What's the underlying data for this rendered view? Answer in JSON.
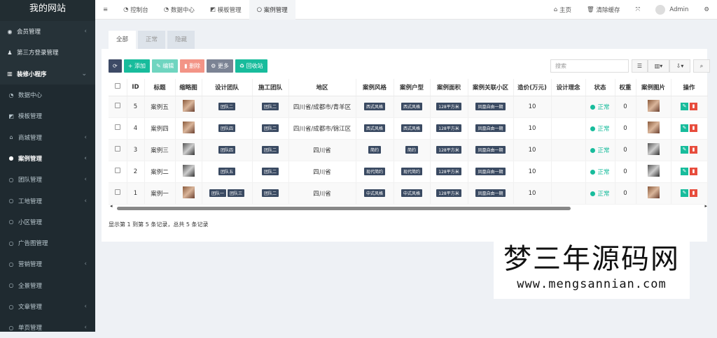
{
  "app": {
    "title": "我的网站"
  },
  "sidebar": {
    "items": [
      {
        "label": "会员管理",
        "icon": "user-circle-icon",
        "arrow": "‹",
        "level": "top"
      },
      {
        "label": "第三方登录管理",
        "icon": "users-icon",
        "arrow": "",
        "level": "top"
      },
      {
        "label": "装修小程序",
        "icon": "bank-icon",
        "arrow": "⌄",
        "level": "top",
        "bold": true
      },
      {
        "label": "数据中心",
        "icon": "dashboard-icon",
        "arrow": "",
        "level": "sub"
      },
      {
        "label": "模板管理",
        "icon": "template-icon",
        "arrow": "",
        "level": "sub"
      },
      {
        "label": "商城管理",
        "icon": "home-icon",
        "arrow": "‹",
        "level": "sub"
      },
      {
        "label": "案例管理",
        "icon": "circle-filled-icon",
        "arrow": "‹",
        "level": "sub",
        "active": true
      },
      {
        "label": "团队管理",
        "icon": "circle-icon",
        "arrow": "‹",
        "level": "sub"
      },
      {
        "label": "工地管理",
        "icon": "circle-icon",
        "arrow": "‹",
        "level": "sub"
      },
      {
        "label": "小区管理",
        "icon": "circle-icon",
        "arrow": "",
        "level": "sub"
      },
      {
        "label": "广告图管理",
        "icon": "circle-icon",
        "arrow": "",
        "level": "sub"
      },
      {
        "label": "营销管理",
        "icon": "circle-icon",
        "arrow": "‹",
        "level": "sub"
      },
      {
        "label": "全景管理",
        "icon": "circle-icon",
        "arrow": "",
        "level": "sub"
      },
      {
        "label": "文章管理",
        "icon": "circle-icon",
        "arrow": "‹",
        "level": "sub"
      },
      {
        "label": "单页管理",
        "icon": "circle-icon",
        "arrow": "‹",
        "level": "sub"
      }
    ]
  },
  "topbar": {
    "menu_icon": "bars-icon",
    "tabs": [
      {
        "label": "控制台",
        "icon": "dashboard-icon"
      },
      {
        "label": "数据中心",
        "icon": "dashboard-icon"
      },
      {
        "label": "模板管理",
        "icon": "template-icon"
      },
      {
        "label": "案例管理",
        "icon": "circle-icon",
        "current": true
      }
    ],
    "home": "主页",
    "clear_cache": "清除缓存",
    "user": "Admin"
  },
  "filter_tabs": [
    "全部",
    "正常",
    "隐藏"
  ],
  "toolbar": {
    "refresh": "",
    "add": "添加",
    "edit": "编辑",
    "delete": "删除",
    "more": "更多",
    "recycle": "回收站",
    "colors": {
      "refresh": "#3d4a66",
      "add": "#18bc9c",
      "edit": "#6fd5c0",
      "delete": "#f39486",
      "more": "#7b8394",
      "recycle": "#18bc9c"
    }
  },
  "search": {
    "placeholder": "搜索"
  },
  "table": {
    "columns": [
      "",
      "ID",
      "标题",
      "缩略图",
      "设计团队",
      "施工团队",
      "地区",
      "案例风格",
      "案例户型",
      "案例面积",
      "案例关联小区",
      "造价(万元)",
      "设计理念",
      "状态",
      "权重",
      "案例图片",
      "操作"
    ],
    "rows": [
      {
        "id": "5",
        "title": "案例五",
        "design": [
          "团队二"
        ],
        "build": "团队二",
        "region": "四川省/成都市/青羊区",
        "style": "西式风格",
        "layout": "西式风格",
        "area": "128平方米",
        "community": "凤凰自由一期",
        "cost": "10",
        "idea": "",
        "status": "正常",
        "weight": "0",
        "img": "warm"
      },
      {
        "id": "4",
        "title": "案例四",
        "design": [
          "团队四"
        ],
        "build": "团队二",
        "region": "四川省/成都市/锦江区",
        "style": "西式风格",
        "layout": "西式风格",
        "area": "128平方米",
        "community": "凤凰自由一期",
        "cost": "10",
        "idea": "",
        "status": "正常",
        "weight": "0",
        "img": "warm"
      },
      {
        "id": "3",
        "title": "案例三",
        "design": [
          "团队四"
        ],
        "build": "团队二",
        "region": "四川省",
        "style": "简约",
        "layout": "简约",
        "area": "128平方米",
        "community": "凤凰自由一期",
        "cost": "10",
        "idea": "",
        "status": "正常",
        "weight": "0",
        "img": "gray"
      },
      {
        "id": "2",
        "title": "案例二",
        "design": [
          "团队五"
        ],
        "build": "团队二",
        "region": "四川省",
        "style": "现代简约",
        "layout": "现代简约",
        "area": "128平方米",
        "community": "凤凰自由一期",
        "cost": "10",
        "idea": "",
        "status": "正常",
        "weight": "0",
        "img": "gray"
      },
      {
        "id": "1",
        "title": "案例一",
        "design": [
          "团队一",
          "团队三"
        ],
        "build": "团队二",
        "region": "四川省",
        "style": "中式风格",
        "layout": "中式风格",
        "area": "128平方米",
        "community": "凤凰自由一期",
        "cost": "10",
        "idea": "",
        "status": "正常",
        "weight": "0",
        "img": "warm"
      }
    ]
  },
  "footer": {
    "summary": "显示第 1 到第 5 条记录，总共 5 条记录"
  },
  "watermark": {
    "line1": "梦三年源码网",
    "line2": "www.mengsannian.com"
  }
}
